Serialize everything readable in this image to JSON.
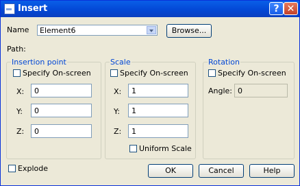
{
  "window": {
    "title": "Insert",
    "help": "?",
    "close": "✕"
  },
  "name": {
    "label": "Name",
    "value": "Element6"
  },
  "browse_label": "Browse...",
  "path_label": "Path:",
  "insertion": {
    "title": "Insertion point",
    "checkbox": "Specify On-screen",
    "x_label": "X:",
    "x_value": "0",
    "y_label": "Y:",
    "y_value": "0",
    "z_label": "Z:",
    "z_value": "0"
  },
  "scale": {
    "title": "Scale",
    "checkbox": "Specify On-screen",
    "x_label": "X:",
    "x_value": "1",
    "y_label": "Y:",
    "y_value": "1",
    "z_label": "Z:",
    "z_value": "1",
    "uniform": "Uniform Scale"
  },
  "rotation": {
    "title": "Rotation",
    "checkbox": "Specify On-screen",
    "angle_label": "Angle:",
    "angle_value": "0"
  },
  "explode_label": "Explode",
  "buttons": {
    "ok": "OK",
    "cancel": "Cancel",
    "help": "Help"
  }
}
